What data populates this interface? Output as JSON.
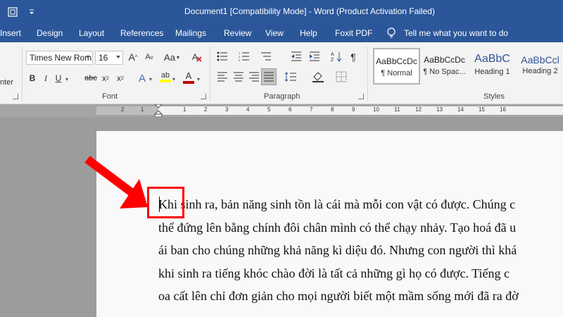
{
  "window": {
    "title": "Document1 [Compatibility Mode]  -  Word (Product Activation Failed)"
  },
  "tabs": [
    {
      "label": "Insert"
    },
    {
      "label": "Design"
    },
    {
      "label": "Layout"
    },
    {
      "label": "References"
    },
    {
      "label": "Mailings"
    },
    {
      "label": "Review"
    },
    {
      "label": "View"
    },
    {
      "label": "Help"
    },
    {
      "label": "Foxit PDF"
    }
  ],
  "tell_me": {
    "label": "Tell me what you want to do",
    "icon": "lightbulb-icon"
  },
  "clipboard": {
    "cut_label": "nter"
  },
  "font": {
    "name": "Times New Rom",
    "size": "16",
    "grow_label": "A",
    "shrink_label": "A",
    "case_label": "Aa",
    "bold_label": "B",
    "italic_label": "I",
    "underline_label": "U",
    "strike_label": "abc",
    "sub_label": "x",
    "sup_label": "x",
    "effects_label": "A",
    "highlight_label": "ab",
    "color_label": "A",
    "group_label": "Font",
    "highlight_color": "#ffff00",
    "font_color": "#c00000"
  },
  "paragraph": {
    "group_label": "Paragraph",
    "show_marks_label": "¶"
  },
  "styles": {
    "group_label": "Styles",
    "items": [
      {
        "preview": "AaBbCcDc",
        "name": "¶ Normal"
      },
      {
        "preview": "AaBbCcDc",
        "name": "¶ No Spac..."
      },
      {
        "preview": "AaBbC",
        "name": "Heading 1"
      },
      {
        "preview": "AaBbCcl",
        "name": "Heading 2"
      }
    ]
  },
  "ruler": {
    "numbers": [
      "2",
      "1",
      "1",
      "2",
      "3",
      "4",
      "5",
      "6",
      "7",
      "8",
      "9",
      "10",
      "11",
      "12",
      "13",
      "14",
      "15",
      "16"
    ]
  },
  "document": {
    "lines": [
      "Khi sinh ra, bản năng sinh tồn là cái mà mỗi con vật có được. Chúng c",
      "thể đứng lên bằng chính đôi chân mình có thể chạy nhảy. Tạo hoá đã u",
      "ái ban cho chúng những khả năng kì diệu đó. Nhưng con người thì khá",
      "khi sinh ra tiếng khóc chào đời là tất cả những gì họ có được. Tiếng c",
      "oa cất lên chỉ đơn giản cho mọi người biết một mầm sống mới đã ra đờ"
    ]
  },
  "annotation": {
    "color": "#ff0000"
  }
}
